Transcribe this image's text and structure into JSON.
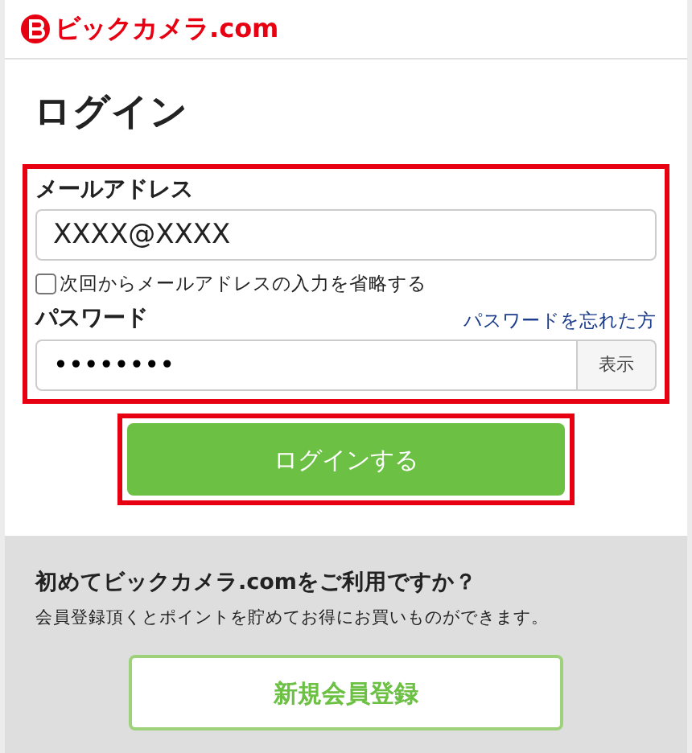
{
  "header": {
    "logo_text": "ビックカメラ.com"
  },
  "title": "ログイン",
  "form": {
    "email_label": "メールアドレス",
    "email_value": "XXXX@XXXX",
    "remember": {
      "label": "次回からメールアドレスの入力を省略する",
      "checked": false
    },
    "password_label": "パスワード",
    "forgot_link": "パスワードを忘れた方",
    "password_value": "••••••••",
    "show_button": "表示"
  },
  "login_button": "ログインする",
  "register": {
    "heading": "初めてビックカメラ.comをご利用ですか？",
    "text": "会員登録頂くとポイントを貯めてお得にお買いものができます。",
    "button": "新規会員登録"
  }
}
